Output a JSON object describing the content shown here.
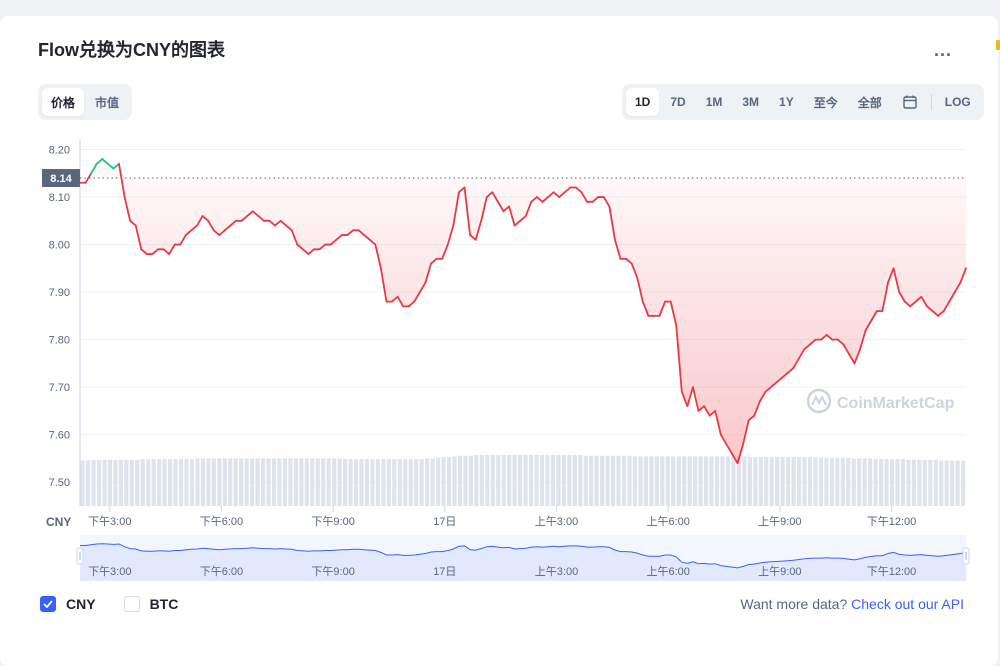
{
  "title": "Flow兑换为CNY的图表",
  "more_label": "...",
  "metric_tabs": [
    {
      "label": "价格",
      "active": true
    },
    {
      "label": "市值",
      "active": false
    }
  ],
  "range_tabs": [
    {
      "label": "1D",
      "active": true
    },
    {
      "label": "7D",
      "active": false
    },
    {
      "label": "1M",
      "active": false
    },
    {
      "label": "3M",
      "active": false
    },
    {
      "label": "1Y",
      "active": false
    },
    {
      "label": "至今",
      "active": false
    },
    {
      "label": "全部",
      "active": false
    }
  ],
  "log_label": "LOG",
  "currency_axis_label": "CNY",
  "watermark": "CoinMarketCap",
  "legend": [
    {
      "label": "CNY",
      "checked": true
    },
    {
      "label": "BTC",
      "checked": false
    }
  ],
  "api_prompt": "Want more data?",
  "api_link": "Check out our API",
  "colors": {
    "down": "#ea3943",
    "up": "#16c784",
    "accent": "#3861fb",
    "volume": "#dfe3ea",
    "navigator_fill": "#e3e9fc",
    "navigator_line": "#3861fb"
  },
  "chart_data": {
    "type": "area",
    "ylim": [
      7.45,
      8.22
    ],
    "yticks": [
      "8.20",
      "8.10",
      "8.00",
      "7.90",
      "7.80",
      "7.70",
      "7.60",
      "7.50"
    ],
    "ytick_values": [
      8.2,
      8.1,
      8.0,
      7.9,
      7.8,
      7.7,
      7.6,
      7.5
    ],
    "reference_value": 8.14,
    "reference_label": "8.14",
    "xticks": [
      "下午3:00",
      "下午6:00",
      "下午9:00",
      "17日",
      "上午3:00",
      "上午6:00",
      "上午9:00",
      "下午12:00"
    ],
    "xtick_hours": [
      15,
      18,
      21,
      24,
      27,
      30,
      33,
      36
    ],
    "x_start_hour": 14.2,
    "x_end_hour": 38.0,
    "series": [
      {
        "values": [
          8.13,
          8.13,
          8.15,
          8.17,
          8.18,
          8.17,
          8.16,
          8.17,
          8.1,
          8.05,
          8.04,
          7.99,
          7.98,
          7.98,
          7.99,
          7.99,
          7.98,
          8.0,
          8.0,
          8.02,
          8.03,
          8.04,
          8.06,
          8.05,
          8.03,
          8.02,
          8.03,
          8.04,
          8.05,
          8.05,
          8.06,
          8.07,
          8.06,
          8.05,
          8.05,
          8.04,
          8.05,
          8.04,
          8.03,
          8.0,
          7.99,
          7.98,
          7.99,
          7.99,
          8.0,
          8.0,
          8.01,
          8.02,
          8.02,
          8.03,
          8.03,
          8.02,
          8.01,
          8.0,
          7.95,
          7.88,
          7.88,
          7.89,
          7.87,
          7.87,
          7.88,
          7.9,
          7.92,
          7.96,
          7.97,
          7.97,
          8.0,
          8.04,
          8.11,
          8.12,
          8.02,
          8.01,
          8.05,
          8.1,
          8.11,
          8.09,
          8.07,
          8.08,
          8.04,
          8.05,
          8.06,
          8.09,
          8.1,
          8.09,
          8.1,
          8.11,
          8.1,
          8.11,
          8.12,
          8.12,
          8.11,
          8.09,
          8.09,
          8.1,
          8.1,
          8.08,
          8.01,
          7.97,
          7.97,
          7.96,
          7.93,
          7.88,
          7.85,
          7.85,
          7.85,
          7.88,
          7.88,
          7.83,
          7.69,
          7.66,
          7.7,
          7.65,
          7.66,
          7.64,
          7.65,
          7.6,
          7.58,
          7.56,
          7.54,
          7.58,
          7.63,
          7.64,
          7.67,
          7.69,
          7.7,
          7.71,
          7.72,
          7.73,
          7.74,
          7.76,
          7.78,
          7.79,
          7.8,
          7.8,
          7.81,
          7.8,
          7.8,
          7.79,
          7.77,
          7.75,
          7.78,
          7.82,
          7.84,
          7.86,
          7.86,
          7.92,
          7.95,
          7.9,
          7.88,
          7.87,
          7.88,
          7.89,
          7.87,
          7.86,
          7.85,
          7.86,
          7.88,
          7.9,
          7.92,
          7.95
        ],
        "volume": [
          0.66,
          0.66,
          0.67,
          0.67,
          0.67,
          0.67,
          0.67,
          0.67,
          0.67,
          0.67,
          0.67,
          0.68,
          0.68,
          0.68,
          0.68,
          0.68,
          0.68,
          0.68,
          0.68,
          0.68,
          0.68,
          0.69,
          0.69,
          0.69,
          0.69,
          0.69,
          0.69,
          0.69,
          0.69,
          0.69,
          0.69,
          0.69,
          0.69,
          0.69,
          0.69,
          0.69,
          0.69,
          0.69,
          0.69,
          0.69,
          0.69,
          0.69,
          0.69,
          0.69,
          0.69,
          0.69,
          0.69,
          0.69,
          0.68,
          0.68,
          0.68,
          0.68,
          0.68,
          0.68,
          0.68,
          0.68,
          0.68,
          0.68,
          0.68,
          0.68,
          0.68,
          0.68,
          0.68,
          0.69,
          0.69,
          0.7,
          0.71,
          0.71,
          0.72,
          0.73,
          0.73,
          0.73,
          0.74,
          0.74,
          0.74,
          0.74,
          0.74,
          0.74,
          0.74,
          0.74,
          0.74,
          0.74,
          0.74,
          0.74,
          0.74,
          0.74,
          0.74,
          0.74,
          0.74,
          0.74,
          0.74,
          0.74,
          0.73,
          0.73,
          0.73,
          0.73,
          0.73,
          0.73,
          0.73,
          0.73,
          0.73,
          0.72,
          0.72,
          0.72,
          0.72,
          0.72,
          0.72,
          0.72,
          0.72,
          0.72,
          0.72,
          0.72,
          0.72,
          0.72,
          0.72,
          0.72,
          0.72,
          0.72,
          0.72,
          0.72,
          0.72,
          0.72,
          0.71,
          0.71,
          0.71,
          0.71,
          0.71,
          0.71,
          0.71,
          0.71,
          0.71,
          0.71,
          0.71,
          0.71,
          0.71,
          0.7,
          0.7,
          0.7,
          0.7,
          0.7,
          0.7,
          0.69,
          0.69,
          0.69,
          0.69,
          0.68,
          0.68,
          0.68,
          0.68,
          0.68,
          0.68,
          0.67,
          0.67,
          0.67,
          0.67,
          0.67,
          0.67,
          0.66,
          0.66,
          0.66,
          0.66,
          0.66
        ]
      }
    ]
  }
}
